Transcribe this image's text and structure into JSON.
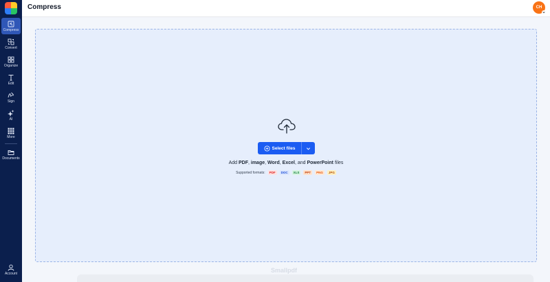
{
  "app": {
    "brand": "Smallpdf"
  },
  "header": {
    "title": "Compress",
    "avatar_initials": "CH"
  },
  "sidebar": {
    "items": [
      {
        "label": "Compress",
        "icon": "compress-icon",
        "active": true
      },
      {
        "label": "Convert",
        "icon": "convert-icon"
      },
      {
        "label": "Organize",
        "icon": "organize-icon"
      },
      {
        "label": "Edit",
        "icon": "text-edit-icon"
      },
      {
        "label": "Sign",
        "icon": "signature-icon"
      },
      {
        "label": "AI",
        "icon": "ai-sparkle-icon"
      },
      {
        "label": "More",
        "icon": "grid-more-icon"
      },
      {
        "label": "Documents",
        "icon": "folder-icon"
      }
    ],
    "account_label": "Account"
  },
  "dropzone": {
    "select_label": "Select files",
    "add_prefix": "Add ",
    "types": [
      "PDF",
      "image",
      "Word",
      "Excel",
      "PowerPoint"
    ],
    "sep1": ", ",
    "sep_and": ", and ",
    "add_suffix": " files",
    "supported_label": "Supported formats:",
    "formats": [
      "PDF",
      "DOC",
      "XLS",
      "PPT",
      "PNG",
      "JPG"
    ]
  },
  "colors": {
    "sidebar_bg": "#0b1f4d",
    "accent": "#1b5cf2",
    "avatar": "#f97316",
    "dropzone_bg": "#e6eefc"
  }
}
